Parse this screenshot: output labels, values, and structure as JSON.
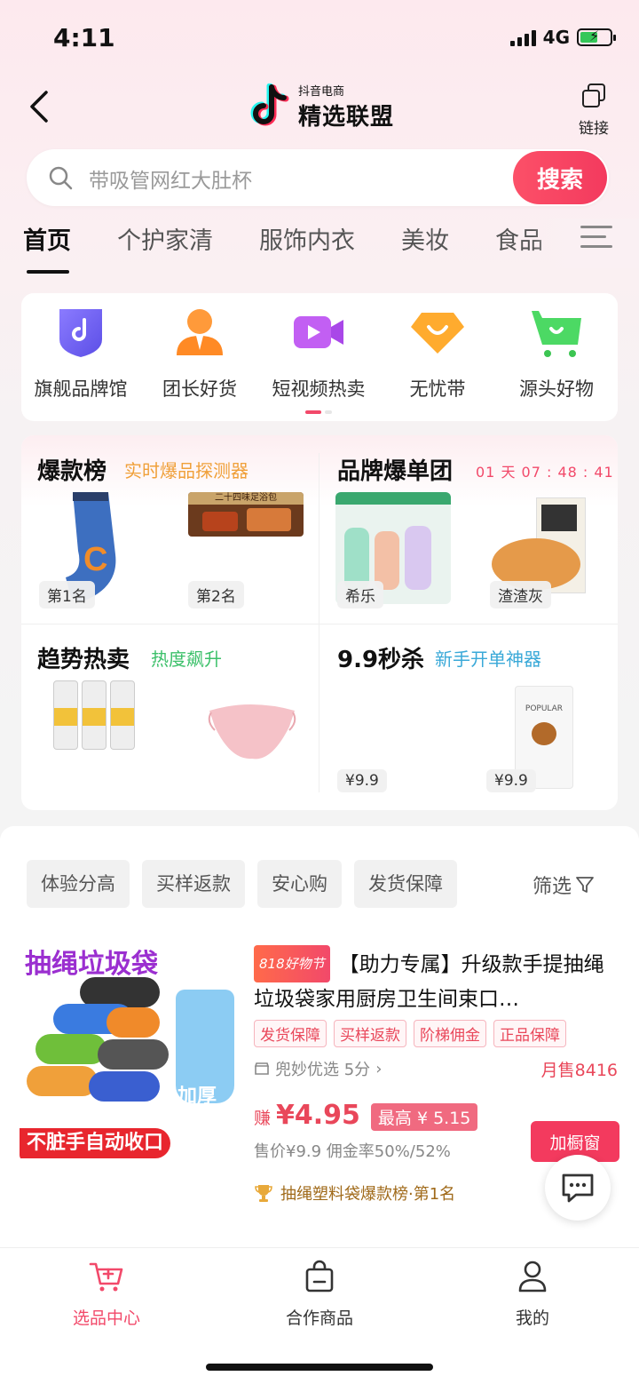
{
  "status": {
    "time": "4:11",
    "network": "4G"
  },
  "header": {
    "logo_small": "抖音电商",
    "logo_big": "精选联盟",
    "link_label": "链接"
  },
  "search": {
    "placeholder": "带吸管网红大肚杯",
    "button": "搜索"
  },
  "tabs": [
    "首页",
    "个护家清",
    "服饰内衣",
    "美妆",
    "食品"
  ],
  "quick_entries": [
    "旗舰品牌馆",
    "团长好货",
    "短视频热卖",
    "无忧带",
    "源头好物"
  ],
  "feature": {
    "hot": {
      "title": "爆款榜",
      "subtitle": "实时爆品探测器",
      "rank1": "第1名",
      "rank2": "第2名",
      "snack_text": "二十四味足浴包"
    },
    "brand": {
      "title": "品牌爆单团",
      "countdown": "01 天 07 : 48 : 41",
      "brand1": "希乐",
      "brand2": "渣渣灰"
    },
    "trend": {
      "title": "趋势热卖",
      "subtitle": "热度飙升"
    },
    "flash": {
      "title": "9.9秒杀",
      "subtitle": "新手开单神器",
      "price1": "¥9.9",
      "price2": "¥9.9",
      "bag_text": "POPULAR"
    }
  },
  "filters": {
    "chips": [
      "体验分高",
      "买样返款",
      "安心购",
      "发货保障"
    ],
    "filter_label": "筛选"
  },
  "product": {
    "image_title": "抽绳垃圾袋",
    "image_badge": "加厚\n加大",
    "image_bottom": "不脏手自动收口",
    "promo_badge": "818好物节",
    "title": "【助力专属】升级款手提抽绳垃圾袋家用厨房卫生间束口…",
    "tags": [
      "发货保障",
      "买样返款",
      "阶梯佣金",
      "正品保障"
    ],
    "shop": "兜妙优选 5分",
    "monthly_sales": "月售8416",
    "earn_label": "赚",
    "earn_price": "¥4.95",
    "max_price": "最高 ¥ 5.15",
    "sub_price": "售价¥9.9   佣金率50%/52%",
    "add_button": "加橱窗",
    "rank_text": "抽绳塑料袋爆款榜·第1名"
  },
  "bottom_nav": [
    "选品中心",
    "合作商品",
    "我的"
  ],
  "colors": {
    "accent": "#f2496a",
    "search_button": "#f33a5e"
  }
}
